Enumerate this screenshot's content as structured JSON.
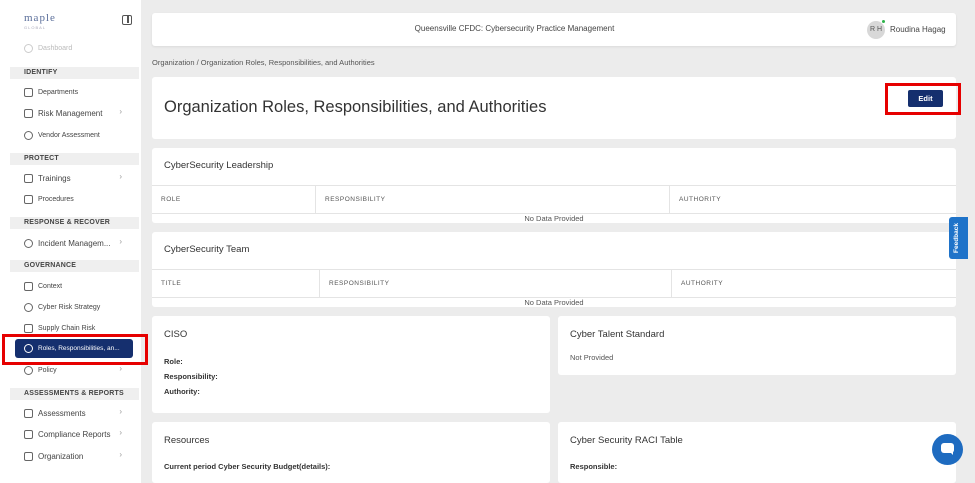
{
  "sidebar": {
    "logo": "maple",
    "logo_sub": "GLOBAL",
    "dashboard": "Dashboard",
    "sections": {
      "identify": "IDENTIFY",
      "protect": "PROTECT",
      "response": "RESPONSE & RECOVER",
      "governance": "GOVERNANCE",
      "assessments": "ASSESSMENTS & REPORTS"
    },
    "items": {
      "departments": "Departments",
      "risk_management": "Risk Management",
      "vendor_assessment": "Vendor Assessment",
      "trainings": "Trainings",
      "procedures": "Procedures",
      "incident_management": "Incident Managem...",
      "context": "Context",
      "cyber_risk_strategy": "Cyber Risk Strategy",
      "supply_chain_risk": "Supply Chain Risk",
      "roles": "Roles, Responsibilities, an...",
      "policy": "Policy",
      "assessments": "Assessments",
      "compliance_reports": "Compliance Reports",
      "organization": "Organization"
    }
  },
  "topbar": {
    "title": "Queensville CFDC: Cybersecurity Practice Management",
    "avatar_initials": "R H",
    "user_name": "Roudina Hagag"
  },
  "breadcrumb": "Organization  /  Organization Roles, Responsibilities, and Authorities",
  "page": {
    "title": "Organization Roles, Responsibilities, and Authorities",
    "edit_label": "Edit"
  },
  "leadership": {
    "title": "CyberSecurity Leadership",
    "columns": [
      "ROLE",
      "RESPONSIBILITY",
      "AUTHORITY"
    ],
    "empty": "No Data Provided"
  },
  "team": {
    "title": "CyberSecurity Team",
    "columns": [
      "TITLE",
      "RESPONSIBILITY",
      "AUTHORITY"
    ],
    "empty": "No Data Provided"
  },
  "ciso": {
    "title": "CISO",
    "role": "Role:",
    "responsibility": "Responsibility:",
    "authority": "Authority:"
  },
  "talent": {
    "title": "Cyber Talent Standard",
    "value": "Not Provided"
  },
  "resources": {
    "title": "Resources",
    "budget": "Current period Cyber Security Budget(details):"
  },
  "raci": {
    "title": "Cyber Security RACI Table",
    "responsible": "Responsible:"
  },
  "feedback": "Feedback",
  "icons": [
    "collapse-icon",
    "dashboard-icon",
    "departments-icon",
    "risk-icon",
    "vendor-icon",
    "trainings-icon",
    "procedures-icon",
    "incident-icon",
    "context-icon",
    "strategy-icon",
    "supply-chain-icon",
    "roles-icon",
    "policy-icon",
    "assessments-icon",
    "compliance-icon",
    "organization-icon",
    "chat-icon"
  ]
}
